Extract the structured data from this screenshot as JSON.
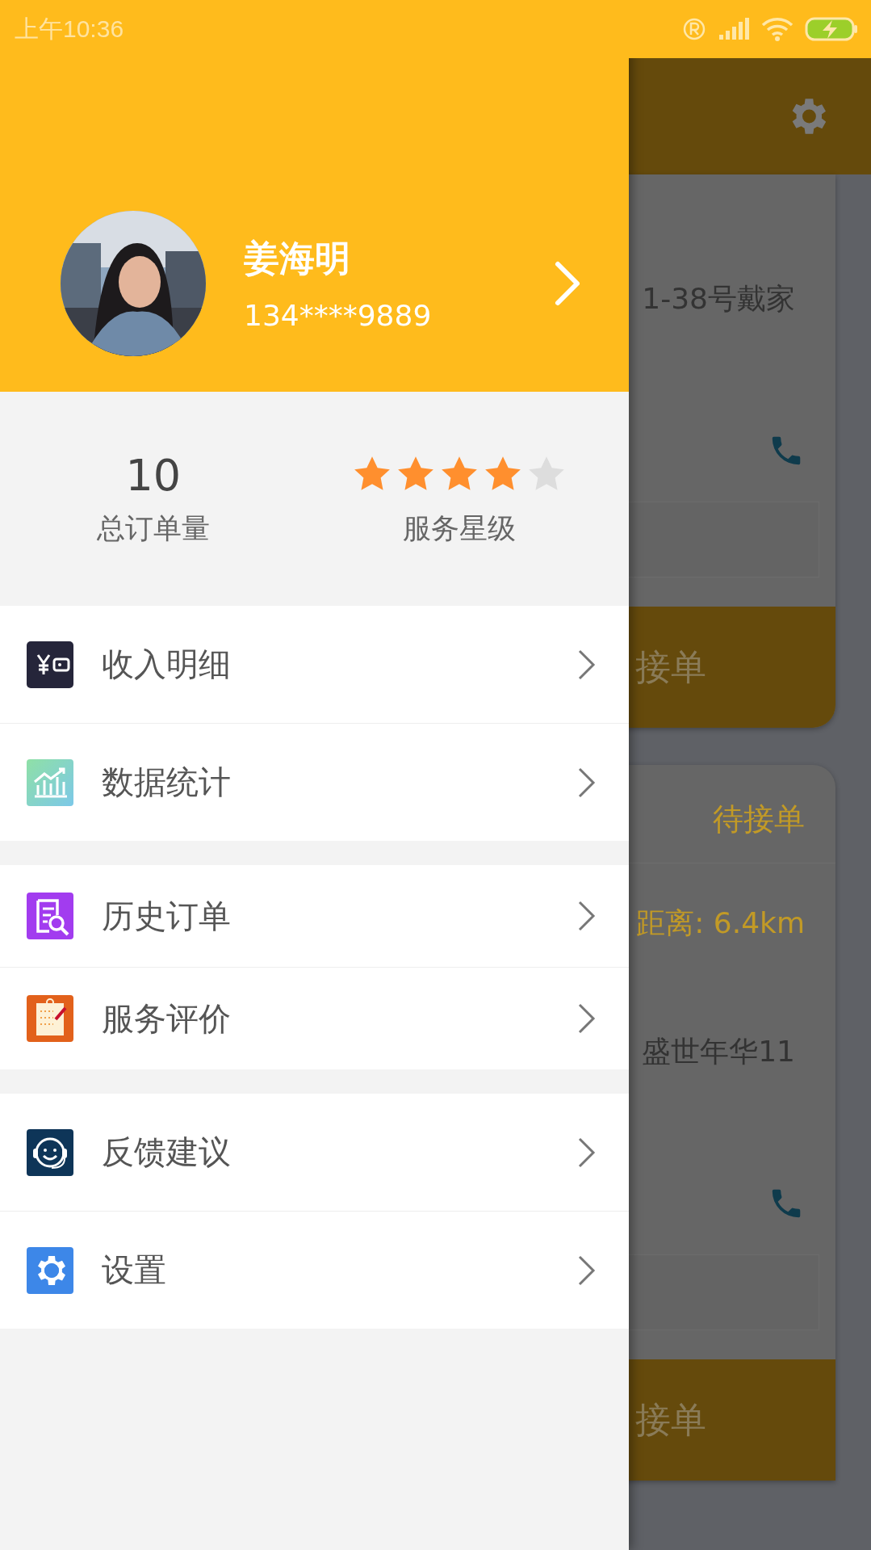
{
  "status_bar": {
    "time": "上午10:36"
  },
  "drawer": {
    "profile": {
      "name": "姜海明",
      "phone": "134****9889"
    },
    "order_count": {
      "value": "10",
      "label": "总订单量"
    },
    "rating": {
      "stars": 4,
      "label": "服务星级"
    },
    "menu_groups": [
      {
        "items": [
          {
            "label": "收入明细"
          },
          {
            "label": "数据统计"
          }
        ]
      },
      {
        "items": [
          {
            "label": "历史订单"
          },
          {
            "label": "服务评价"
          }
        ]
      },
      {
        "items": [
          {
            "label": "反馈建议"
          },
          {
            "label": "设置"
          }
        ]
      }
    ]
  },
  "background_page": {
    "cards": [
      {
        "address": "1-38号戴家",
        "button": "接单"
      },
      {
        "status": "待接单",
        "distance": "距离: 6.4km",
        "address": "盛世年华11",
        "button": "接单"
      }
    ]
  }
}
